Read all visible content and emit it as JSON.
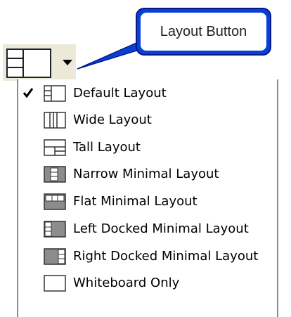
{
  "callout": {
    "text": "Layout Button"
  },
  "button": {
    "icon": "default-layout-icon",
    "arrow": "dropdown-arrow-icon"
  },
  "menu": {
    "items": [
      {
        "label": "Default Layout",
        "icon": "default-layout-icon",
        "checked": true
      },
      {
        "label": "Wide Layout",
        "icon": "wide-layout-icon",
        "checked": false
      },
      {
        "label": "Tall Layout",
        "icon": "tall-layout-icon",
        "checked": false
      },
      {
        "label": "Narrow Minimal Layout",
        "icon": "narrow-minimal-layout-icon",
        "checked": false
      },
      {
        "label": "Flat Minimal Layout",
        "icon": "flat-minimal-layout-icon",
        "checked": false
      },
      {
        "label": "Left Docked Minimal Layout",
        "icon": "left-docked-minimal-layout-icon",
        "checked": false
      },
      {
        "label": "Right Docked Minimal Layout",
        "icon": "right-docked-minimal-layout-icon",
        "checked": false
      },
      {
        "label": "Whiteboard Only",
        "icon": "whiteboard-only-icon",
        "checked": false
      }
    ]
  },
  "colors": {
    "callout_fill": "#0a3fd6",
    "callout_border": "#001a8c",
    "button_bg": "#ece9d8",
    "menu_border": "#8a8a8a"
  }
}
